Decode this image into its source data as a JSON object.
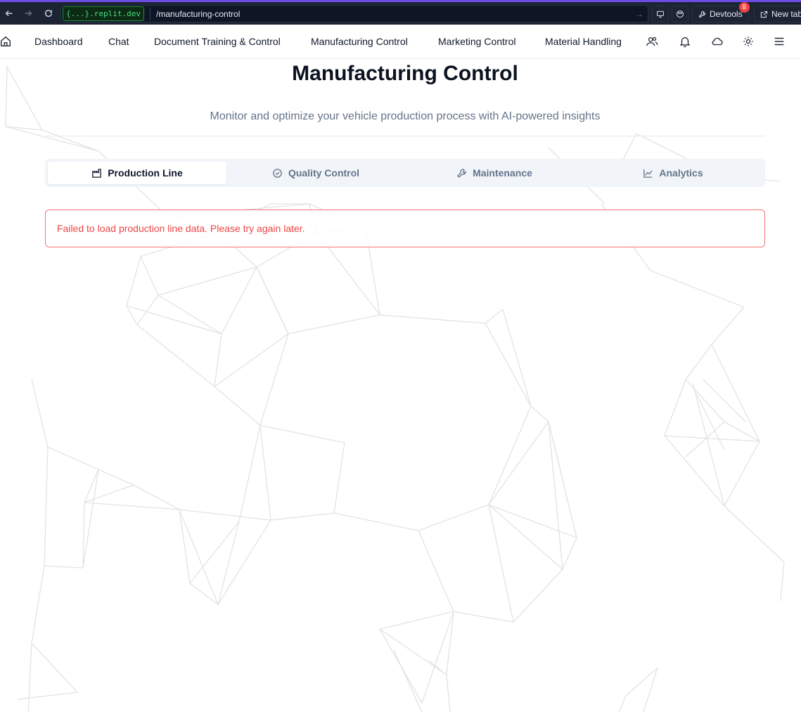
{
  "browser": {
    "url_domain_prefix": "{...}",
    "url_domain_suffix": ".replit.dev",
    "url_path": "/manufacturing-control",
    "devtools_label": "Devtools",
    "devtools_badge": "8",
    "new_tab_label": "New tab"
  },
  "nav": {
    "items": [
      {
        "label": "Dashboard"
      },
      {
        "label": "Chat"
      },
      {
        "label": "Document Training & Control"
      },
      {
        "label": "Manufacturing Control"
      },
      {
        "label": "Marketing Control"
      },
      {
        "label": "Material Handling"
      }
    ],
    "icons": [
      "home-icon",
      "users-icon",
      "bell-icon",
      "cloud-icon",
      "gear-icon",
      "menu-icon"
    ]
  },
  "page": {
    "title": "Manufacturing Control",
    "subtitle": "Monitor and optimize your vehicle production process with AI-powered insights"
  },
  "tabs": [
    {
      "label": "Production Line",
      "icon": "factory-icon",
      "active": true
    },
    {
      "label": "Quality Control",
      "icon": "check-circle-icon",
      "active": false
    },
    {
      "label": "Maintenance",
      "icon": "wrench-icon",
      "active": false
    },
    {
      "label": "Analytics",
      "icon": "line-chart-icon",
      "active": false
    }
  ],
  "alert": {
    "message": "Failed to load production line data. Please try again later."
  },
  "colors": {
    "accent": "#6d4ce6",
    "error": "#ef4444",
    "network_line": "#e5e5e5"
  }
}
